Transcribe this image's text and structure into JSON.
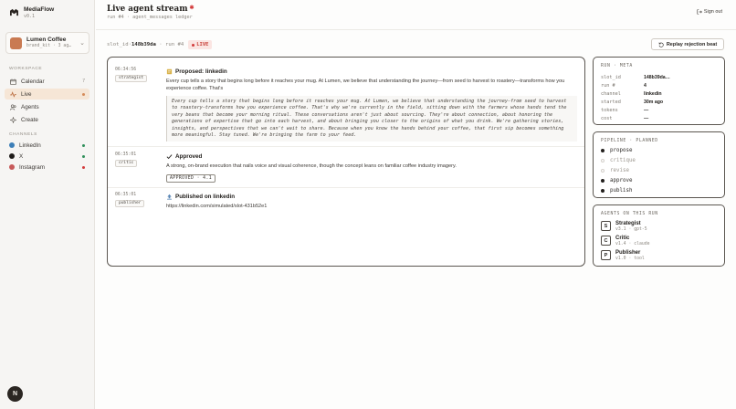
{
  "brand": {
    "name": "MediaFlow",
    "version": "v0.1"
  },
  "project": {
    "name": "Lumen Coffee",
    "subtitle": "brand_kit · 3 ag…"
  },
  "sidebar": {
    "workspace_label": "WORKSPACE",
    "items": [
      {
        "label": "Calendar",
        "icon": "calendar-icon",
        "count": "7"
      },
      {
        "label": "Live",
        "icon": "pulse-icon",
        "active": true
      },
      {
        "label": "Agents",
        "icon": "agents-icon"
      },
      {
        "label": "Create",
        "icon": "sparkle-icon"
      }
    ],
    "channels_label": "CHANNELS",
    "channels": [
      {
        "label": "LinkedIn",
        "color": "#3d7fb8",
        "status_color": "#2f8f5a"
      },
      {
        "label": "X",
        "color": "#1f1c1a",
        "status_color": "#2f8f5a"
      },
      {
        "label": "Instagram",
        "color": "#c75a5a",
        "status_color": "#d33b3b"
      }
    ],
    "user_initial": "N"
  },
  "header": {
    "title": "Live agent stream",
    "subtitle": "run #4 · agent_messages ledger",
    "signout_label": "Sign out"
  },
  "slot": {
    "prefix": "slot_id·",
    "id": "148b39da",
    "run": "· run #4",
    "live_label": "LIVE"
  },
  "replay_label": "Replay rejection beat",
  "stream": [
    {
      "time": "06:34:56",
      "agent": "strategist",
      "title": "Proposed: linkedin",
      "text": "Every cup tells a story that begins long before it reaches your mug. At Lumen, we believe that understanding the journey—from seed to harvest to roastery—transforms how you experience coffee. That's",
      "quote": "Every cup tells a story that begins long before it reaches your mug. At Lumen, we believe that understanding the journey—from seed to harvest to roastery—transforms how you experience coffee. That's why we're currently in the field, sitting down with the farmers whose hands tend the very beans that become your morning ritual. These conversations aren't just about sourcing. They're about connection, about honoring the generations of expertise that go into each harvest, and about bringing you closer to the origins of what you drink. We're gathering stories, insights, and perspectives that we can't wait to share. Because when you know the hands behind your coffee, that first sip becomes something more meaningful. Stay tuned. We're bringing the farm to your feed."
    },
    {
      "time": "06:35:01",
      "agent": "critic",
      "title": "Approved",
      "text": "A strong, on-brand execution that nails voice and visual coherence, though the concept leans on familiar coffee industry imagery.",
      "badge": "APPROVED · 4.1"
    },
    {
      "time": "06:35:01",
      "agent": "publisher",
      "title": "Published on linkedin",
      "text": "https://linkedin.com/simulated/slot-431b52e1"
    }
  ],
  "run_meta": {
    "title": "RUN · META",
    "rows": [
      {
        "key": "slot_id",
        "value": "148b39da…"
      },
      {
        "key": "run #",
        "value": "4"
      },
      {
        "key": "channel",
        "value": "linkedin"
      },
      {
        "key": "started",
        "value": "30m ago"
      },
      {
        "key": "tokens",
        "value": "—"
      },
      {
        "key": "cost",
        "value": "—"
      }
    ]
  },
  "pipeline": {
    "title": "PIPELINE · PLANNED",
    "steps": [
      {
        "label": "propose",
        "done": true
      },
      {
        "label": "critique",
        "done": false
      },
      {
        "label": "revise",
        "done": false
      },
      {
        "label": "approve",
        "done": true
      },
      {
        "label": "publish",
        "done": true
      }
    ]
  },
  "agents": {
    "title": "AGENTS ON THIS RUN",
    "list": [
      {
        "letter": "S",
        "name": "Strategist",
        "sub": "v3.1 · gpt-5"
      },
      {
        "letter": "C",
        "name": "Critic",
        "sub": "v1.4 · claude"
      },
      {
        "letter": "P",
        "name": "Publisher",
        "sub": "v1.0 · tool"
      }
    ]
  }
}
